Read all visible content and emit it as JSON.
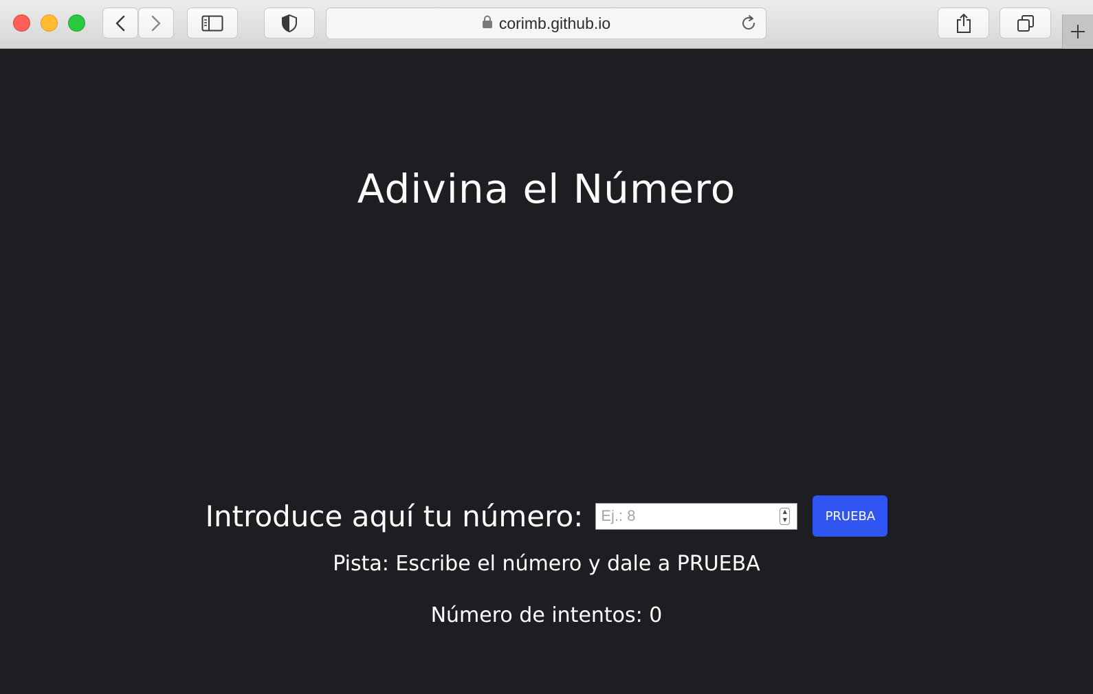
{
  "browser": {
    "url": "corimb.github.io",
    "icons": [
      "close-icon",
      "minimize-icon",
      "maximize-icon",
      "back-icon",
      "forward-icon",
      "sidebar-icon",
      "shield-icon",
      "lock-icon",
      "reload-icon",
      "share-icon",
      "tabs-overview-icon",
      "new-tab-icon"
    ]
  },
  "page": {
    "title": "Adivina el Número",
    "guess_label": "Introduce aquí tu número:",
    "guess_placeholder": "Ej.: 8",
    "guess_value": "",
    "try_button": "PRUEBA",
    "hint": "Pista: Escribe el número y dale a PRUEBA",
    "attempts": "Número de intentos: 0"
  },
  "colors": {
    "background": "#1d1e22",
    "button": "#3055f2",
    "text": "#ffffff"
  }
}
